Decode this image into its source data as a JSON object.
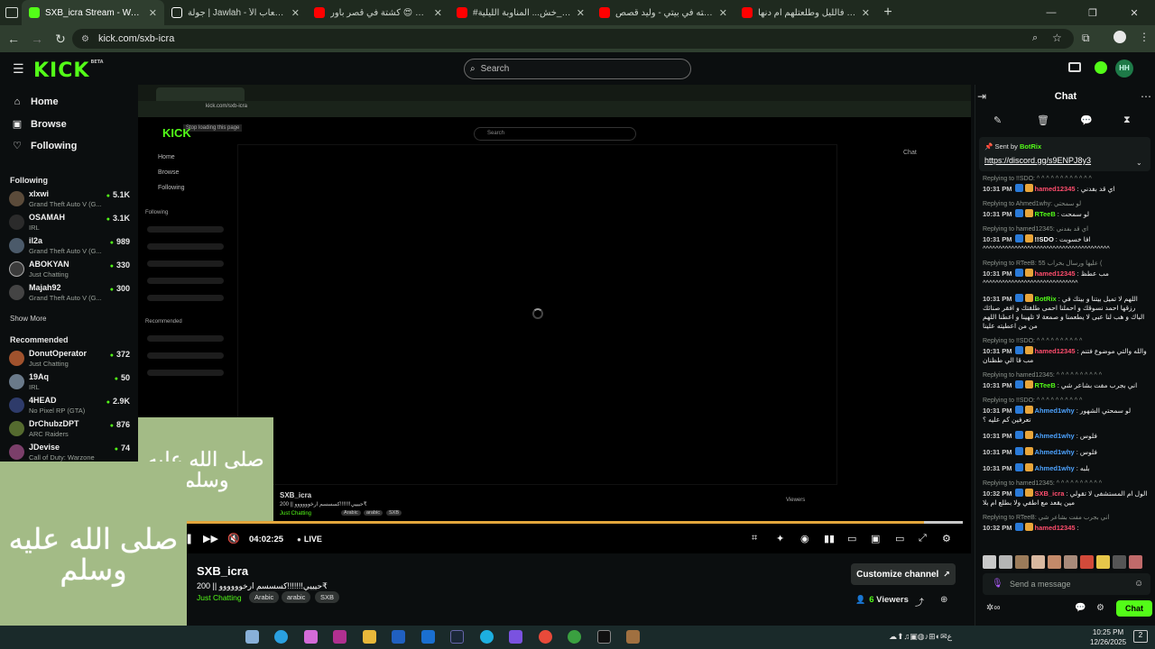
{
  "browser": {
    "tabs": [
      {
        "title": "SXB_icra Stream - Watch Live o",
        "active": true,
        "favicon_color": "#53fc18"
      },
      {
        "title": "جولة | Jawlah - منصة الألعاب الأ",
        "active": false,
        "favicon_color": "#ffffff"
      },
      {
        "title": "كشتة في قصر باور 😍 🔥 Tube",
        "active": false,
        "favicon_color": "#ff0000"
      },
      {
        "title": "#قصص_خش... المناوبة الليلية 👤",
        "active": false,
        "favicon_color": "#ff0000"
      },
      {
        "title": "لقيته في بيتي - وليد قصص  - oe",
        "active": false,
        "favicon_color": "#ff0000"
      },
      {
        "title": "راحو البر فالليل وطلعتلهم ام دنها",
        "active": false,
        "favicon_color": "#ff0000"
      }
    ],
    "new_tab": "+",
    "window_controls": {
      "minimize": "—",
      "restore": "❐",
      "close": "✕"
    },
    "url": "kick.com/sxb-icra",
    "nav": {
      "back": "←",
      "forward": "→",
      "reload": "↻"
    }
  },
  "kick": {
    "logo": "KICK",
    "logo_sup": "BETA",
    "search_placeholder": "Search",
    "brand_color": "#53fc18"
  },
  "sidebar": {
    "nav": [
      {
        "label": "Home",
        "icon": "home-icon"
      },
      {
        "label": "Browse",
        "icon": "browse-icon"
      },
      {
        "label": "Following",
        "icon": "heart-icon"
      }
    ],
    "following_header": "Following",
    "following": [
      {
        "name": "xlxwi",
        "category": "Grand Theft Auto V (G...",
        "viewers": "5.1K"
      },
      {
        "name": "OSAMAH",
        "category": "IRL",
        "viewers": "3.1K"
      },
      {
        "name": "il2a",
        "category": "Grand Theft Auto V (G...",
        "viewers": "989"
      },
      {
        "name": "ABOKYAN",
        "category": "Just Chatting",
        "viewers": "330"
      },
      {
        "name": "Majah92",
        "category": "Grand Theft Auto V (G...",
        "viewers": "300"
      }
    ],
    "show_more": "Show More",
    "recommended_header": "Recommended",
    "recommended": [
      {
        "name": "DonutOperator",
        "category": "Just Chatting",
        "viewers": "372"
      },
      {
        "name": "19Aq",
        "category": "IRL",
        "viewers": "50"
      },
      {
        "name": "4HEAD",
        "category": "No Pixel RP (GTA)",
        "viewers": "2.9K"
      },
      {
        "name": "DrChubzDPT",
        "category": "ARC Raiders",
        "viewers": "876"
      },
      {
        "name": "JDevise",
        "category": "Call of Duty: Warzone",
        "viewers": "74"
      }
    ]
  },
  "player": {
    "inner_url": "kick.com/sxb-icra",
    "inner_tooltip": "Stop loading this page",
    "inner_nav": [
      "Home",
      "Browse",
      "Following"
    ],
    "inner_following": "Following",
    "inner_recommended": "Recommended",
    "inner_chat": "Chat",
    "inner_search": "Search",
    "overlay_name": "SXB_icra",
    "overlay_title": "حيييي!!!!!!!كسسسم ارخوووووو || 200₹",
    "overlay_cat": "Just Chatting",
    "overlay_tags": [
      "Arabic",
      "arabic",
      "SXB"
    ],
    "overlay_viewers": "Viewers",
    "timecode": "04:02:25",
    "live": "LIVE",
    "progress": 0.95
  },
  "calligraphy": {
    "text": "صلى الله عليه وسلم"
  },
  "stream": {
    "streamer": "SXB_icra",
    "title": "حيييي!!!!!!!كسسسم ارخوووووو || 200₹",
    "category": "Just Chatting",
    "tags": [
      "Arabic",
      "arabic",
      "SXB"
    ],
    "customize": "Customize channel",
    "viewers_count": "6",
    "viewers_label": "Viewers"
  },
  "chat": {
    "title": "Chat",
    "pinned_by_label": "Sent by",
    "pinned_by": "BotRix",
    "pinned_link": "https://discord.gg/s9ENPJ8y3",
    "messages": [
      {
        "reply": "Replying to !!SDO: ^ ^ ^ ^ ^ ^ ^ ^ ^ ^ ^ ^",
        "time": "10:31 PM",
        "user": "hamed12345",
        "ucolor": "#ff4d6d",
        "text": "اي قد بفدني"
      },
      {
        "reply": "Replying to Ahmed1why: لو سمحتي",
        "time": "10:31 PM",
        "user": "RTeeB",
        "ucolor": "#53fc18",
        "text": "لو سمحت"
      },
      {
        "reply": "Replying to hamed12345: اي قد بفدني",
        "time": "10:31 PM",
        "user": "!!SDO",
        "ucolor": "#ffffff",
        "text": "افا خسوبت ^^^^^^^^^^^^^^^^^^^^^^^^^^^^^^^^^^^^^^^^"
      },
      {
        "reply": "Replying to RTeeB: 55 عليها ورسال بخراب (",
        "time": "10:31 PM",
        "user": "hamed12345",
        "ucolor": "#ff4d6d",
        "text": "مب عطظ ^^^^^^^^^^^^^^^^^^^^^^^^^^^^^^"
      },
      {
        "reply": "",
        "time": "10:31 PM",
        "user": "BotRix",
        "ucolor": "#53fc18",
        "text": "اللهم لا تميل بيتنا و بيتك في رزقها احمد نسوقك و احملنا احمى طلقتك و افقر صنائك الباك و هب لنا عبى لا يطعمنا و صمعة لا تلهينا و اعطنا اللهم من من اعطيته علينا"
      },
      {
        "reply": "Replying to !!SDO: ^ ^ ^ ^ ^ ^ ^ ^ ^ ^",
        "time": "10:31 PM",
        "user": "hamed12345",
        "ucolor": "#ff4d6d",
        "text": "والله والتي موضوع فتنم مب قا الي طظنان"
      },
      {
        "reply": "Replying to hamed12345: ^ ^ ^ ^ ^ ^ ^ ^ ^ ^",
        "time": "10:31 PM",
        "user": "RTeeB",
        "ucolor": "#53fc18",
        "text": "اني بجرب مفت بشاعر شي"
      },
      {
        "reply": "Replying to !!SDO: ^ ^ ^ ^ ^ ^ ^ ^ ^ ^",
        "time": "10:31 PM",
        "user": "Ahmed1why",
        "ucolor": "#4da3ff",
        "text": "لو سمحتي الشهور تعرفين كم عليه ؟"
      },
      {
        "reply": "",
        "time": "10:31 PM",
        "user": "Ahmed1why",
        "ucolor": "#4da3ff",
        "text": "فلوس"
      },
      {
        "reply": "",
        "time": "10:31 PM",
        "user": "Ahmed1why",
        "ucolor": "#4da3ff",
        "text": "فلوس"
      },
      {
        "reply": "",
        "time": "10:31 PM",
        "user": "Ahmed1why",
        "ucolor": "#4da3ff",
        "text": "بلبه"
      },
      {
        "reply": "Replying to hamed12345: ^ ^ ^ ^ ^ ^ ^ ^ ^ ^",
        "time": "10:32 PM",
        "user": "SXB_icra",
        "ucolor": "#ff4d6d",
        "text": "الول ام المستشفى لا تقولي مين يقعد مع اطفي ولا بطلع ام بلا"
      },
      {
        "reply": "Replying to RTeeB: اني بجرب مفت بشاعر شي",
        "time": "10:32 PM",
        "user": "hamed12345",
        "ucolor": "#ff4d6d",
        "text": ""
      }
    ],
    "input_placeholder": "Send a message",
    "send": "Chat"
  },
  "taskbar": {
    "time": "10:25 PM",
    "date": "12/26/2025",
    "notif": "2"
  }
}
